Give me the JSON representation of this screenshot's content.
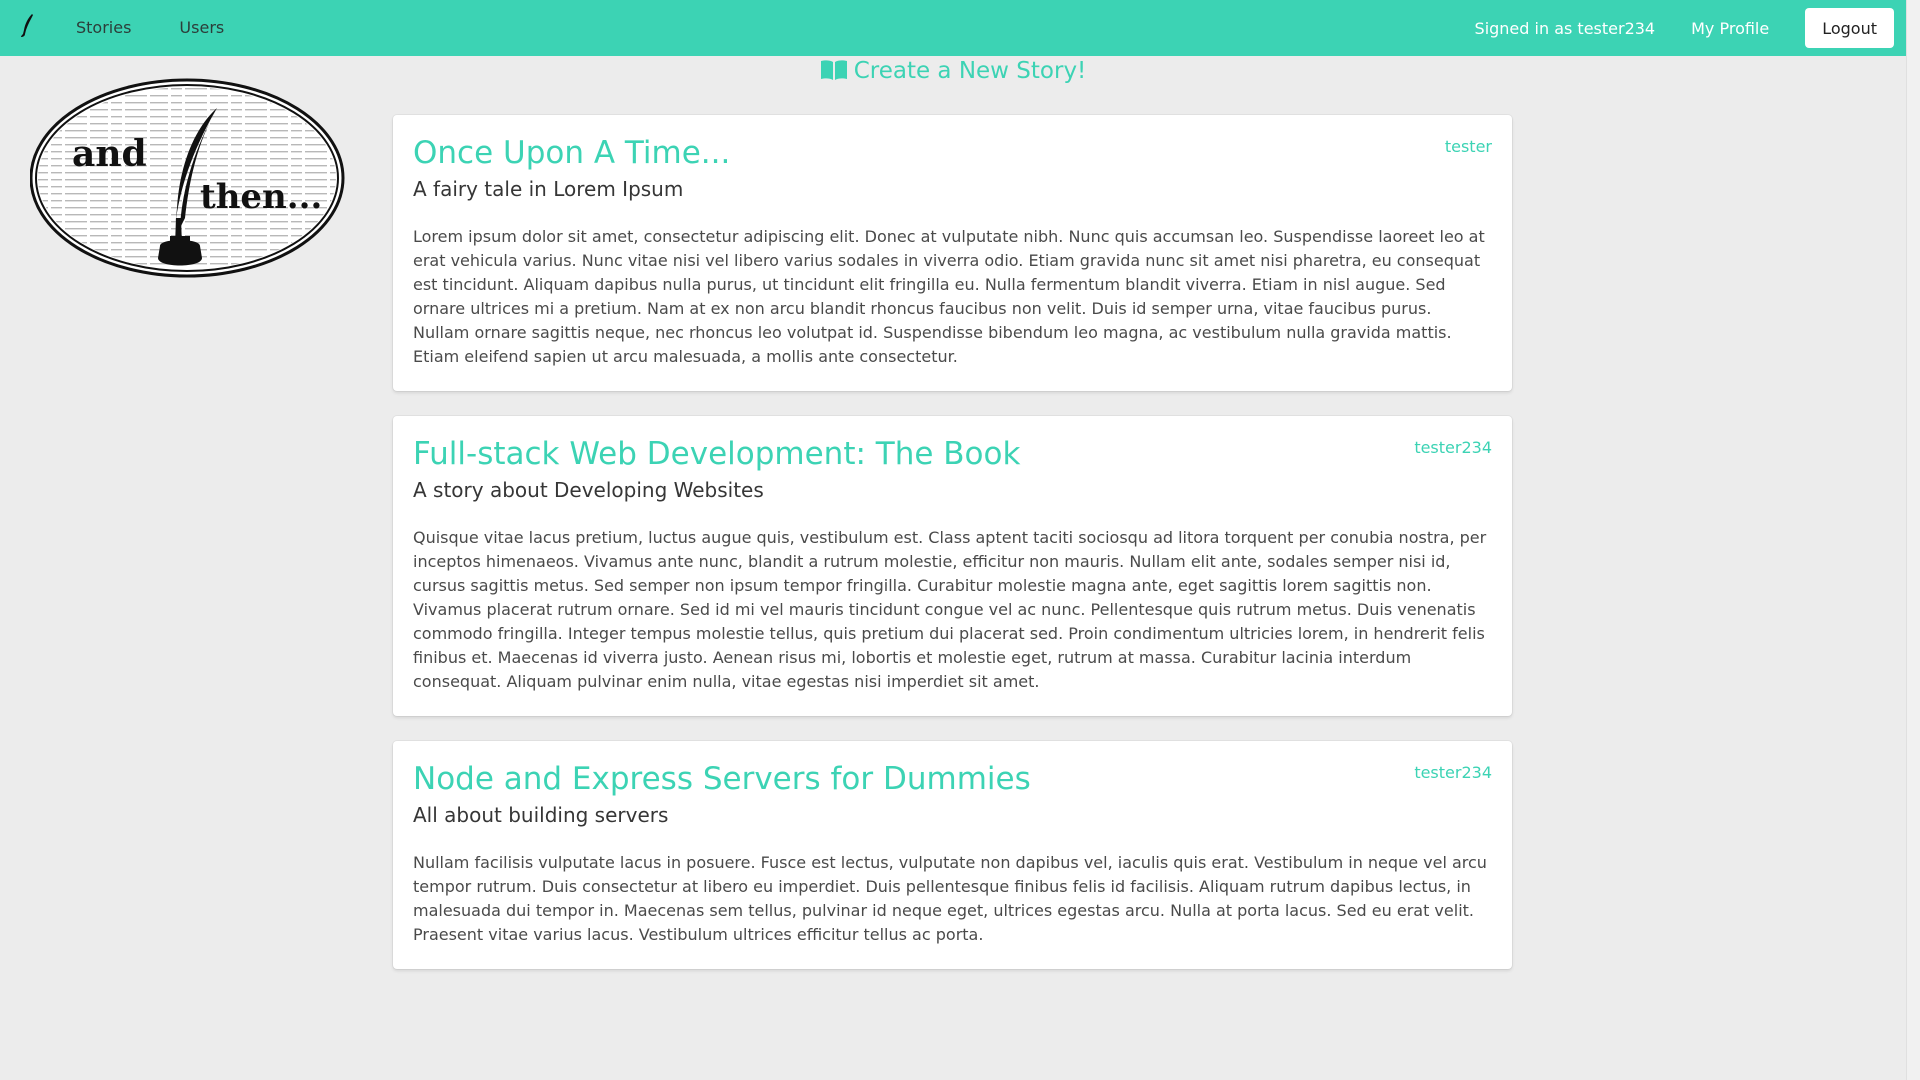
{
  "colors": {
    "accent": "#3cd3b4",
    "background": "#ececec",
    "card": "#ffffff"
  },
  "navbar": {
    "brand_icon": "quill-icon",
    "items": [
      {
        "label": "Stories"
      },
      {
        "label": "Users"
      }
    ],
    "signed_in_text": "Signed in as tester234",
    "profile_label": "My Profile",
    "logout_label": "Logout"
  },
  "logo": {
    "word1": "and",
    "word2": "then..."
  },
  "create_link": {
    "icon": "book-icon",
    "label": "Create a New Story!"
  },
  "stories": [
    {
      "title": "Once Upon A Time...",
      "subtitle": "A fairy tale in Lorem Ipsum",
      "author": "tester",
      "body": "Lorem ipsum dolor sit amet, consectetur adipiscing elit. Donec at vulputate nibh. Nunc quis accumsan leo. Suspendisse laoreet leo at erat vehicula varius. Nunc vitae nisi vel libero varius sodales in viverra odio. Etiam gravida nunc sit amet nisi pharetra, eu consequat est tincidunt. Aliquam dapibus nulla purus, ut tincidunt elit fringilla eu. Nulla fermentum blandit viverra. Etiam in nisl augue. Sed ornare ultrices mi a pretium. Nam at ex non arcu blandit rhoncus faucibus non velit. Duis id semper urna, vitae faucibus purus. Nullam ornare sagittis neque, nec rhoncus leo volutpat id. Suspendisse bibendum leo magna, ac vestibulum nulla gravida mattis. Etiam eleifend sapien ut arcu malesuada, a mollis ante consectetur."
    },
    {
      "title": "Full-stack Web Development: The Book",
      "subtitle": "A story about Developing Websites",
      "author": "tester234",
      "body": "Quisque vitae lacus pretium, luctus augue quis, vestibulum est. Class aptent taciti sociosqu ad litora torquent per conubia nostra, per inceptos himenaeos. Vivamus ante nunc, blandit a rutrum molestie, efficitur non mauris. Nullam elit ante, sodales semper nisi id, cursus sagittis metus. Sed semper non ipsum tempor fringilla. Curabitur molestie magna ante, eget sagittis lorem sagittis non. Vivamus placerat rutrum ornare. Sed id mi vel mauris tincidunt congue vel ac nunc. Pellentesque quis rutrum metus. Duis venenatis commodo fringilla. Integer tempus molestie tellus, quis pretium dui placerat sed. Proin condimentum ultricies lorem, in hendrerit felis finibus et. Maecenas id viverra justo. Aenean risus mi, lobortis et molestie eget, rutrum at massa. Curabitur lacinia interdum consequat. Aliquam pulvinar enim nulla, vitae egestas nisi imperdiet sit amet."
    },
    {
      "title": "Node and Express Servers for Dummies",
      "subtitle": "All about building servers",
      "author": "tester234",
      "body": "Nullam facilisis vulputate lacus in posuere. Fusce est lectus, vulputate non dapibus vel, iaculis quis erat. Vestibulum in neque vel arcu tempor rutrum. Duis consectetur at libero eu imperdiet. Duis pellentesque finibus felis id facilisis. Aliquam rutrum dapibus lectus, in malesuada dui tempor in. Maecenas sem tellus, pulvinar id neque eget, ultrices egestas arcu. Nulla at porta lacus. Sed eu erat velit. Praesent vitae varius lacus. Vestibulum ultrices efficitur tellus ac porta."
    }
  ]
}
